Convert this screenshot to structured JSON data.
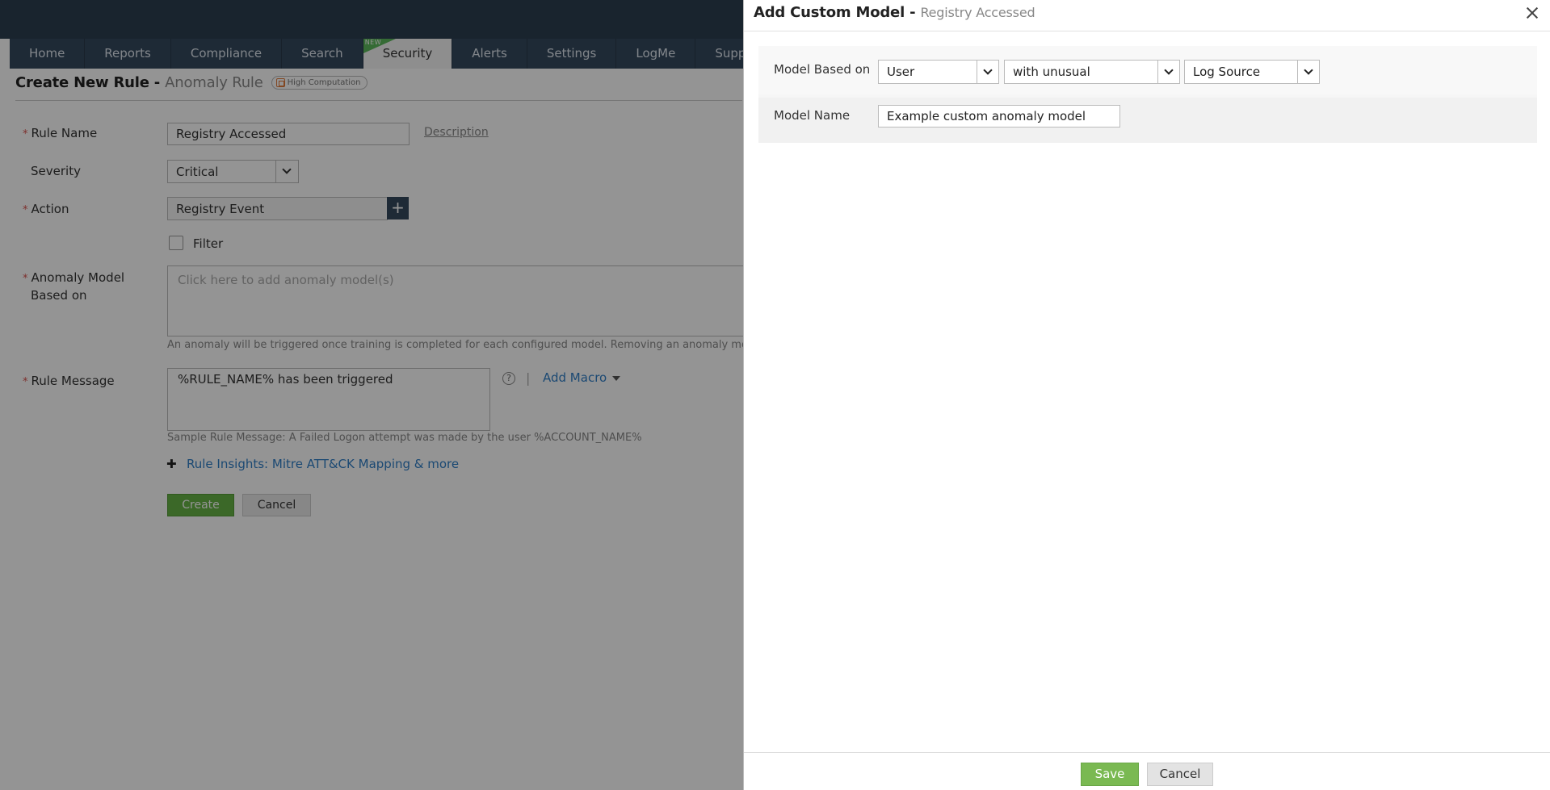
{
  "nav": {
    "tabs": [
      {
        "label": "Home"
      },
      {
        "label": "Reports"
      },
      {
        "label": "Compliance"
      },
      {
        "label": "Search"
      },
      {
        "label": "Security",
        "badge": "NEW",
        "active": true
      },
      {
        "label": "Alerts"
      },
      {
        "label": "Settings"
      },
      {
        "label": "LogMe"
      },
      {
        "label": "Support"
      }
    ]
  },
  "page": {
    "title": "Create New Rule - ",
    "subtitle": "Anomaly Rule",
    "badge": "High Computation",
    "fields": {
      "rule_name_label": "Rule Name",
      "rule_name_value": "Registry Accessed",
      "description_link": "Description",
      "severity_label": "Severity",
      "severity_value": "Critical",
      "action_label": "Action",
      "action_value": "Registry Event",
      "filter_label": "Filter",
      "anomaly_label_1": "Anomaly Model",
      "anomaly_label_2": "Based on",
      "anomaly_placeholder": "Click here to add anomaly model(s)",
      "anomaly_hint": "An anomaly will be triggered once training is completed for each configured model. Removing an anomaly model",
      "rule_message_label": "Rule Message",
      "rule_message_value": "%RULE_NAME% has been triggered",
      "help_glyph": "?",
      "pipe": "|",
      "add_macro": "Add Macro",
      "sample_message": "Sample Rule Message: A Failed Logon attempt was made by the user %ACCOUNT_NAME%",
      "insights_plus": "✚",
      "insights_link": "Rule Insights: Mitre ATT&CK Mapping & more",
      "required_mark": "*"
    },
    "buttons": {
      "create": "Create",
      "cancel": "Cancel"
    }
  },
  "panel": {
    "title": "Add Custom Model - ",
    "subtitle": "Registry Accessed",
    "model_based_on_label": "Model Based on",
    "selects": [
      {
        "value": "User"
      },
      {
        "value": "with unusual"
      },
      {
        "value": "Log Source"
      }
    ],
    "model_name_label": "Model Name",
    "model_name_value": "Example custom anomaly model",
    "save": "Save",
    "cancel": "Cancel"
  },
  "colors": {
    "topbar": "#2c3e50",
    "navbar": "#34495e",
    "primary_green": "#7ab952",
    "link_blue": "#2f7ec7",
    "required_red": "#d9534f"
  }
}
